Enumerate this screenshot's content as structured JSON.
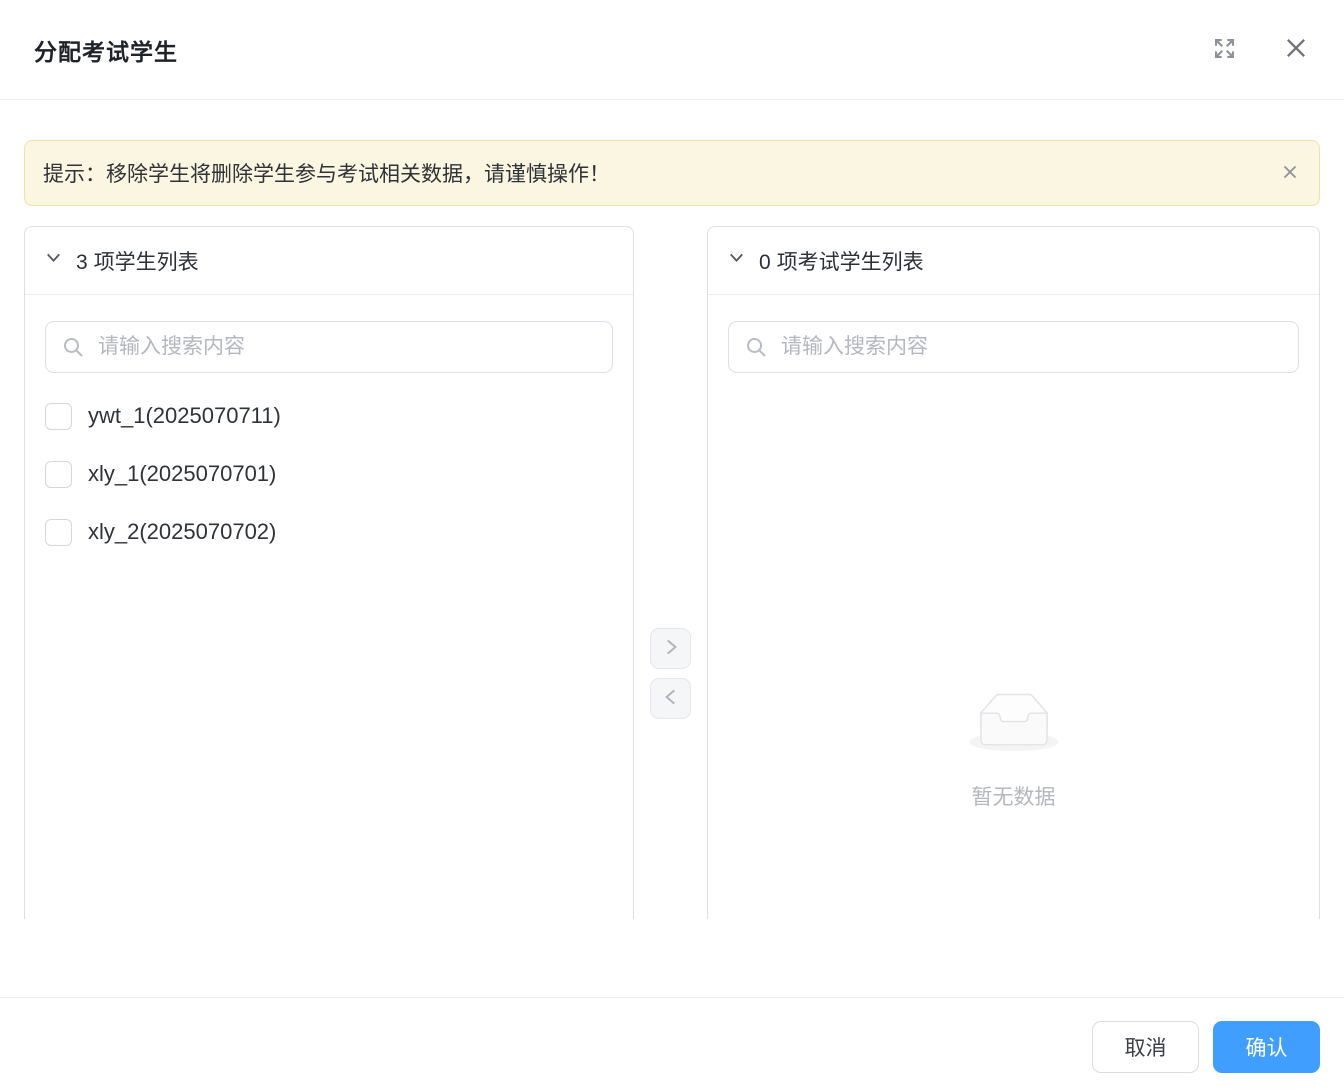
{
  "dialog": {
    "title": "分配考试学生",
    "alert": {
      "text": "提示：移除学生将删除学生参与考试相关数据，请谨慎操作！"
    },
    "source_panel": {
      "count": "3",
      "label": "项学生列表",
      "search_placeholder": "请输入搜索内容",
      "search_value": "",
      "items": [
        {
          "label": "ywt_1(2025070711)",
          "checked": false
        },
        {
          "label": "xly_1(2025070701)",
          "checked": false
        },
        {
          "label": "xly_2(2025070702)",
          "checked": false
        }
      ]
    },
    "target_panel": {
      "count": "0",
      "label": "项考试学生列表",
      "search_placeholder": "请输入搜索内容",
      "search_value": "",
      "empty_text": "暂无数据"
    },
    "icons": {
      "fullscreen": "fullscreen-expand-icon",
      "close": "close-icon",
      "alert_close": "close-icon",
      "collapse": "chevron-down-icon",
      "search": "search-icon",
      "move_right": "chevron-right-icon",
      "move_left": "chevron-left-icon",
      "empty": "empty-box-icon"
    },
    "footer": {
      "cancel_label": "取消",
      "confirm_label": "确认"
    },
    "colors": {
      "primary": "#409eff",
      "alert_bg": "#fbf6e1",
      "alert_border": "#f1e2a5"
    }
  }
}
